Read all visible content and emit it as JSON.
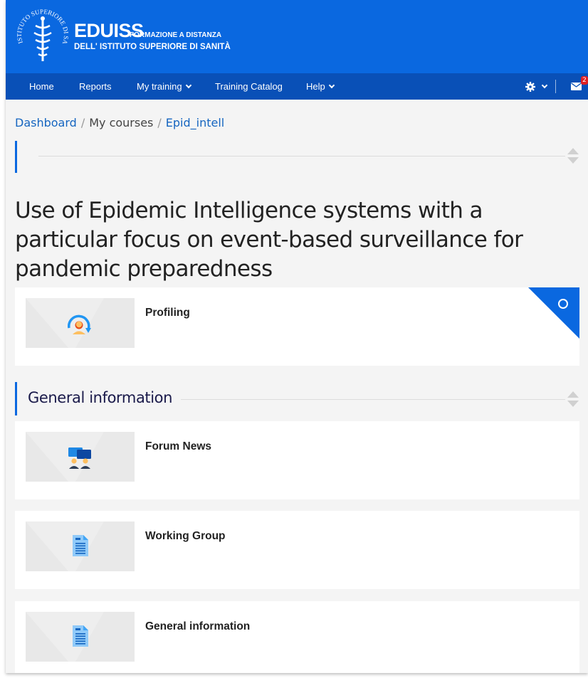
{
  "header": {
    "brand_title": "EDUISS",
    "brand_sub1": "FORMAZIONE A DISTANZA",
    "brand_sub2": "DELL' ISTITUTO SUPERIORE DI SANITÀ",
    "logo_text": "ISTITUTO SUPERIORE DI SANITÀ"
  },
  "nav": {
    "items": [
      {
        "label": "Home"
      },
      {
        "label": "Reports"
      },
      {
        "label": "My training"
      },
      {
        "label": "Training Catalog"
      },
      {
        "label": "Help"
      }
    ],
    "notification_count": "2"
  },
  "breadcrumb": {
    "items": [
      "Dashboard",
      "My courses",
      "Epid_intell"
    ]
  },
  "course": {
    "title": "Use of Epidemic Intelligence systems with a particular focus on event-based surveillance for pandemic preparedness"
  },
  "sections": {
    "general_heading": "General information"
  },
  "activities": [
    {
      "title": "Profiling",
      "icon": "profile-refresh-icon"
    },
    {
      "title": "Forum News",
      "icon": "forum-icon"
    },
    {
      "title": "Working Group",
      "icon": "document-icon"
    },
    {
      "title": "General information",
      "icon": "document-icon"
    }
  ],
  "colors": {
    "brand_blue": "#0a68e0",
    "nav_blue": "#0950b7",
    "link_blue": "#1565c0",
    "badge_red": "#e02020"
  }
}
